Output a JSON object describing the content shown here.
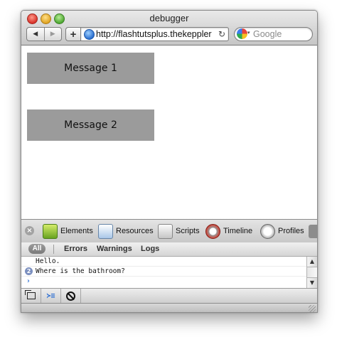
{
  "window": {
    "title": "debugger"
  },
  "toolbar": {
    "back_glyph": "◀",
    "forward_glyph": "▶",
    "add_glyph": "+",
    "url": "http://flashtutsplus.thekeppler",
    "reload_glyph": "↻",
    "search_placeholder": "Google"
  },
  "page": {
    "messages": [
      {
        "label": "Message 1"
      },
      {
        "label": "Message 2"
      }
    ]
  },
  "inspector": {
    "close_glyph": "×",
    "panels": [
      {
        "label": "Elements",
        "icon": "elements-icon"
      },
      {
        "label": "Resources",
        "icon": "resources-icon"
      },
      {
        "label": "Scripts",
        "icon": "scripts-icon"
      },
      {
        "label": "Timeline",
        "icon": "timeline-icon"
      },
      {
        "label": "Profiles",
        "icon": "profiles-icon"
      }
    ],
    "filters": {
      "all": "All",
      "errors": "Errors",
      "warnings": "Warnings",
      "logs": "Logs"
    },
    "console": {
      "lines": [
        {
          "text": "Hello.",
          "repeat": null
        },
        {
          "text": "Where is the bathroom?",
          "repeat": "2"
        }
      ],
      "prompt": "›"
    },
    "scroll": {
      "up": "▲",
      "down": "▼"
    },
    "status_buttons": [
      {
        "name": "dock-icon"
      },
      {
        "name": "console-toggle-icon"
      },
      {
        "name": "clear-console-icon"
      }
    ]
  },
  "colors": {
    "message_box": "#9b9b9b",
    "prompt": "#2d6fd3",
    "repeat_badge": "#7b8fbf"
  }
}
